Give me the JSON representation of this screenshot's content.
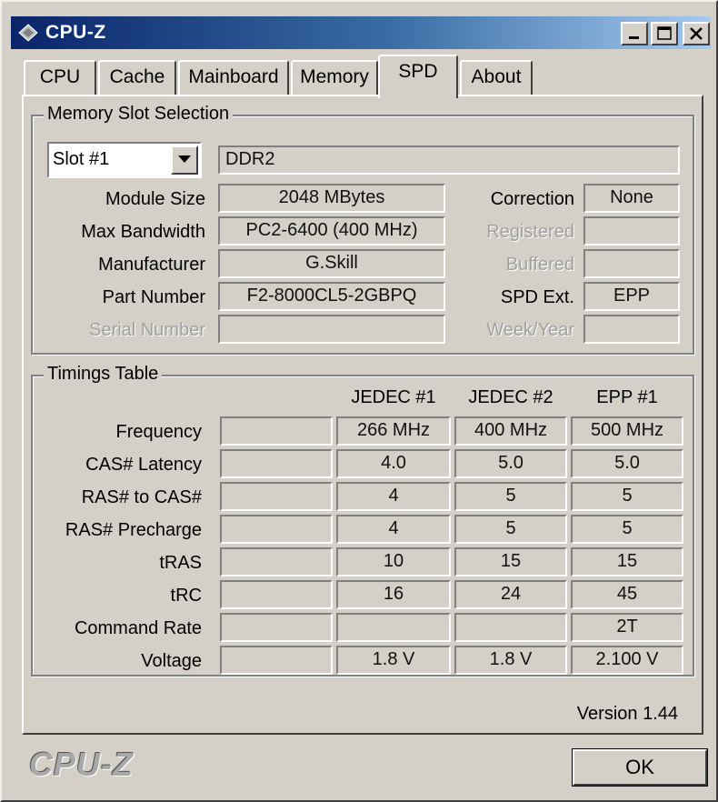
{
  "window": {
    "title": "CPU-Z"
  },
  "tabs": [
    {
      "label": "CPU"
    },
    {
      "label": "Cache"
    },
    {
      "label": "Mainboard"
    },
    {
      "label": "Memory"
    },
    {
      "label": "SPD",
      "active": true
    },
    {
      "label": "About"
    }
  ],
  "slot_group": {
    "title": "Memory Slot Selection",
    "slot_selected": "Slot #1",
    "memory_type": "DDR2",
    "fields": {
      "module_size": {
        "label": "Module Size",
        "value": "2048 MBytes"
      },
      "max_bandwidth": {
        "label": "Max Bandwidth",
        "value": "PC2-6400 (400 MHz)"
      },
      "manufacturer": {
        "label": "Manufacturer",
        "value": "G.Skill"
      },
      "part_number": {
        "label": "Part Number",
        "value": "F2-8000CL5-2GBPQ"
      },
      "serial_number": {
        "label": "Serial Number",
        "value": ""
      },
      "correction": {
        "label": "Correction",
        "value": "None"
      },
      "registered": {
        "label": "Registered",
        "value": ""
      },
      "buffered": {
        "label": "Buffered",
        "value": ""
      },
      "spd_ext": {
        "label": "SPD Ext.",
        "value": "EPP"
      },
      "week_year": {
        "label": "Week/Year",
        "value": ""
      }
    }
  },
  "timings": {
    "title": "Timings Table",
    "columns": [
      "",
      "JEDEC #1",
      "JEDEC #2",
      "EPP #1"
    ],
    "rows": [
      {
        "label": "Frequency",
        "values": [
          "",
          "266 MHz",
          "400 MHz",
          "500 MHz"
        ]
      },
      {
        "label": "CAS# Latency",
        "values": [
          "",
          "4.0",
          "5.0",
          "5.0"
        ]
      },
      {
        "label": "RAS# to CAS#",
        "values": [
          "",
          "4",
          "5",
          "5"
        ]
      },
      {
        "label": "RAS# Precharge",
        "values": [
          "",
          "4",
          "5",
          "5"
        ]
      },
      {
        "label": "tRAS",
        "values": [
          "",
          "10",
          "15",
          "15"
        ]
      },
      {
        "label": "tRC",
        "values": [
          "",
          "16",
          "24",
          "45"
        ]
      },
      {
        "label": "Command Rate",
        "values": [
          "",
          "",
          "",
          "2T"
        ]
      },
      {
        "label": "Voltage",
        "values": [
          "",
          "1.8 V",
          "1.8 V",
          "2.100 V"
        ]
      }
    ]
  },
  "footer": {
    "version": "Version 1.44",
    "brand": "CPU-Z",
    "ok_label": "OK"
  }
}
